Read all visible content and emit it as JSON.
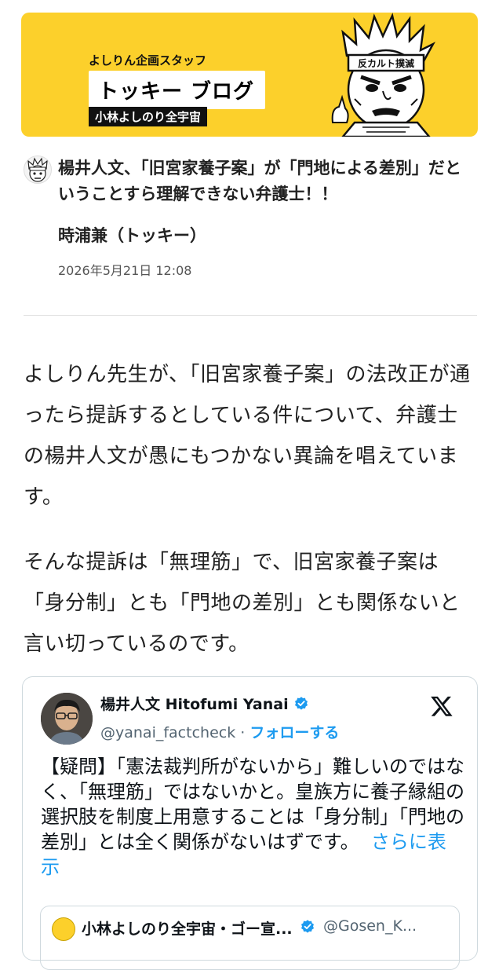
{
  "banner": {
    "subtitle": "よしりん企画スタッフ",
    "title": "トッキー ブログ",
    "tag": "小林よしのり全宇宙",
    "mascot_headband": "反カルト撲滅"
  },
  "article": {
    "headline": "楊井人文、「旧宮家養子案」が「門地による差別」だということすら理解できない弁護士！！",
    "author": "時浦兼（トッキー）",
    "date": "2026年5月21日 12:08",
    "paragraphs": [
      "よしりん先生が、「旧宮家養子案」の法改正が通ったら提訴するとしている件について、弁護士の楊井人文が愚にもつかない異論を唱えています。",
      "そんな提訴は「無理筋」で、旧宮家養子案は「身分制」とも「門地の差別」とも関係ないと言い切っているのです。"
    ]
  },
  "tweet": {
    "name": "楊井人文 Hitofumi Yanai",
    "handle": "@yanai_factcheck",
    "separator": "·",
    "follow_label": "フォローする",
    "text": "【疑問】「憲法裁判所がないから」難しいのではなく、「無理筋」ではないかと。皇族方に養子縁組の選択肢を制度上用意することは「身分制」「門地の差別」とは全く関係がないはずです。",
    "more_label": "さらに表示",
    "quoted": {
      "name": "小林よしのり全宇宙・ゴー宣...",
      "handle": "@Gosen_K..."
    }
  },
  "colors": {
    "banner_bg": "#fcd02b",
    "link_blue": "#1d9bf0",
    "verified_blue": "#1d9bf0"
  }
}
